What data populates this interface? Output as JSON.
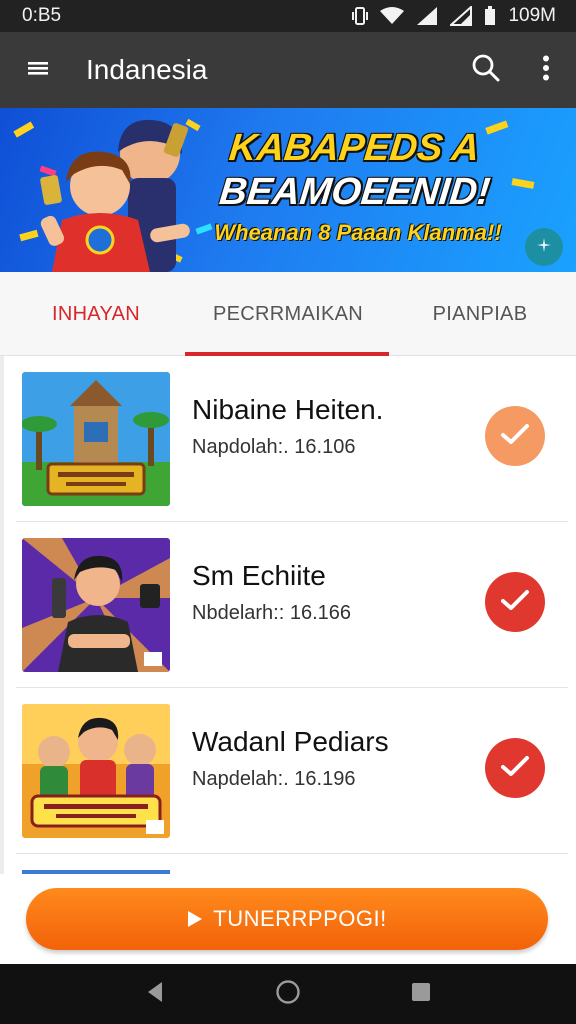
{
  "status": {
    "time": "0:B5",
    "battery": "109M"
  },
  "app_bar": {
    "title": "Indanesia"
  },
  "banner": {
    "headline_1": "KABAPEDS A",
    "headline_2": "BEAMOEENID!",
    "subline": "Wheanan 8 Paaan Klanma!!"
  },
  "tabs": [
    {
      "label": "INHAYAN",
      "active": true
    },
    {
      "label": "PECRRMAIKAN",
      "active": false
    },
    {
      "label": "PIANPIAB",
      "active": false
    }
  ],
  "items": [
    {
      "title": "Nibaine Heiten.",
      "subtitle": "Napdolah:. 16.106",
      "check_color": "#f69a63"
    },
    {
      "title": "Sm Echiite",
      "subtitle": "Nbdelarh:: 16.166",
      "check_color": "#e0382e"
    },
    {
      "title": "Wadanl Pediars",
      "subtitle": "Napdelah:. 16.196",
      "check_color": "#e0382e"
    }
  ],
  "cta": {
    "label": "TUNERRPPOGI!"
  },
  "colors": {
    "accent": "#d8262a",
    "cta": "#f27313",
    "app_bar": "#3a3a3a"
  }
}
